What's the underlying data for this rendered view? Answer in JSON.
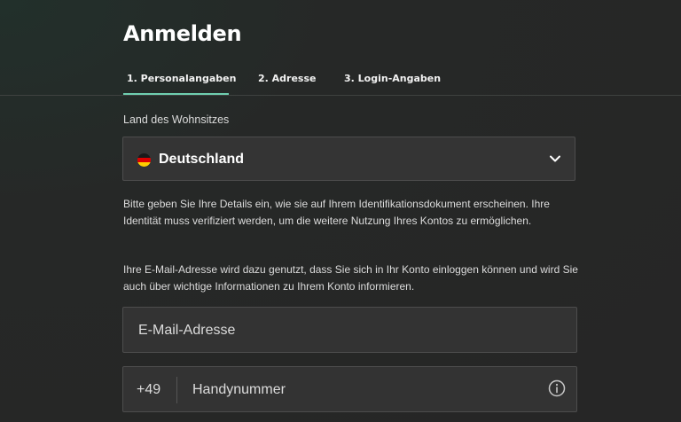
{
  "page": {
    "title": "Anmelden"
  },
  "tabs": [
    {
      "label": "1.  Personalangaben",
      "active": true
    },
    {
      "label": "2.  Adresse",
      "active": false
    },
    {
      "label": "3.  Login-Angaben",
      "active": false
    }
  ],
  "country": {
    "label": "Land des Wohnsitzes",
    "selected": "Deutschland",
    "flag_icon": "germany-flag-icon",
    "dropdown_icon": "chevron-down-icon"
  },
  "info": {
    "identity_text": "Bitte geben Sie Ihre Details ein, wie sie auf Ihrem Identifikationsdokument erscheinen. Ihre Identität muss verifiziert werden, um die weitere Nutzung Ihres Kontos zu ermöglichen.",
    "email_text": "Ihre E-Mail-Adresse wird dazu genutzt, dass Sie sich in Ihr Konto einloggen können und wird Sie auch über wichtige Informationen zu Ihrem Konto informieren."
  },
  "email": {
    "placeholder": "E-Mail-Adresse",
    "value": ""
  },
  "phone": {
    "prefix": "+49",
    "placeholder": "Handynummer",
    "value": "",
    "info_icon": "info-icon"
  },
  "colors": {
    "background": "#262626",
    "accent": "#6fcfb0",
    "field_background": "#343434",
    "field_border": "#4d4d4d"
  }
}
